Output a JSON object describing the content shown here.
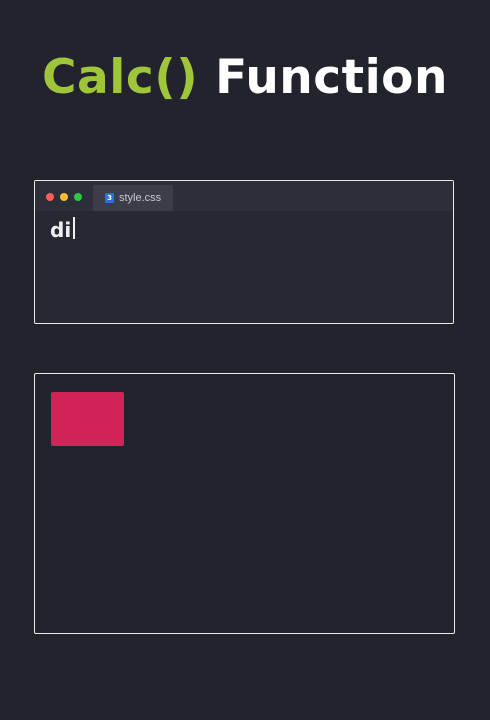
{
  "title": {
    "accent": "Calc()",
    "rest": "Function"
  },
  "editor": {
    "tab_label": "style.css",
    "tab_icon_glyph": "3",
    "code_text": "di",
    "window_controls": [
      "close-dot",
      "minimize-dot",
      "maximize-dot"
    ]
  },
  "preview": {
    "box_color": "#d22358"
  },
  "colors": {
    "background": "#22232c",
    "accent": "#9fc53a",
    "box": "#d22358",
    "css_icon": "#2e6fd8"
  }
}
